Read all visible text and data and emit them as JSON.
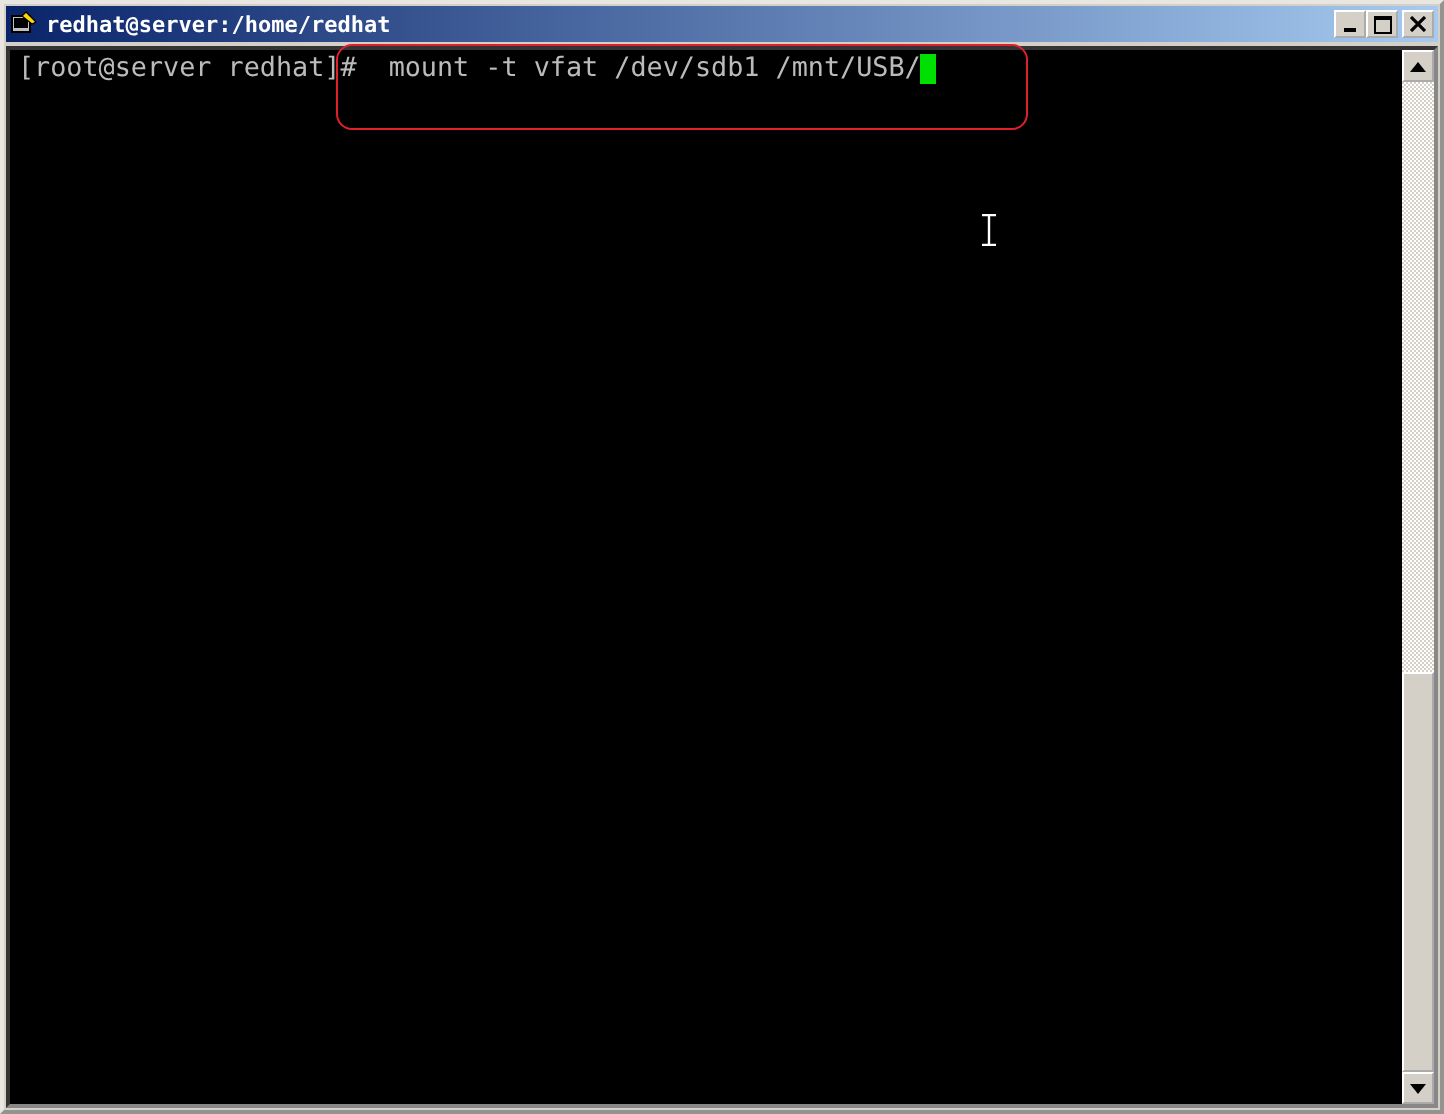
{
  "window": {
    "title": "redhat@server:/home/redhat"
  },
  "terminal": {
    "lines": [
      {
        "prompt": "[root@server redhat]#",
        "command": "mount -t vfat /dev/sdb1 /mnt/USB/"
      }
    ]
  }
}
